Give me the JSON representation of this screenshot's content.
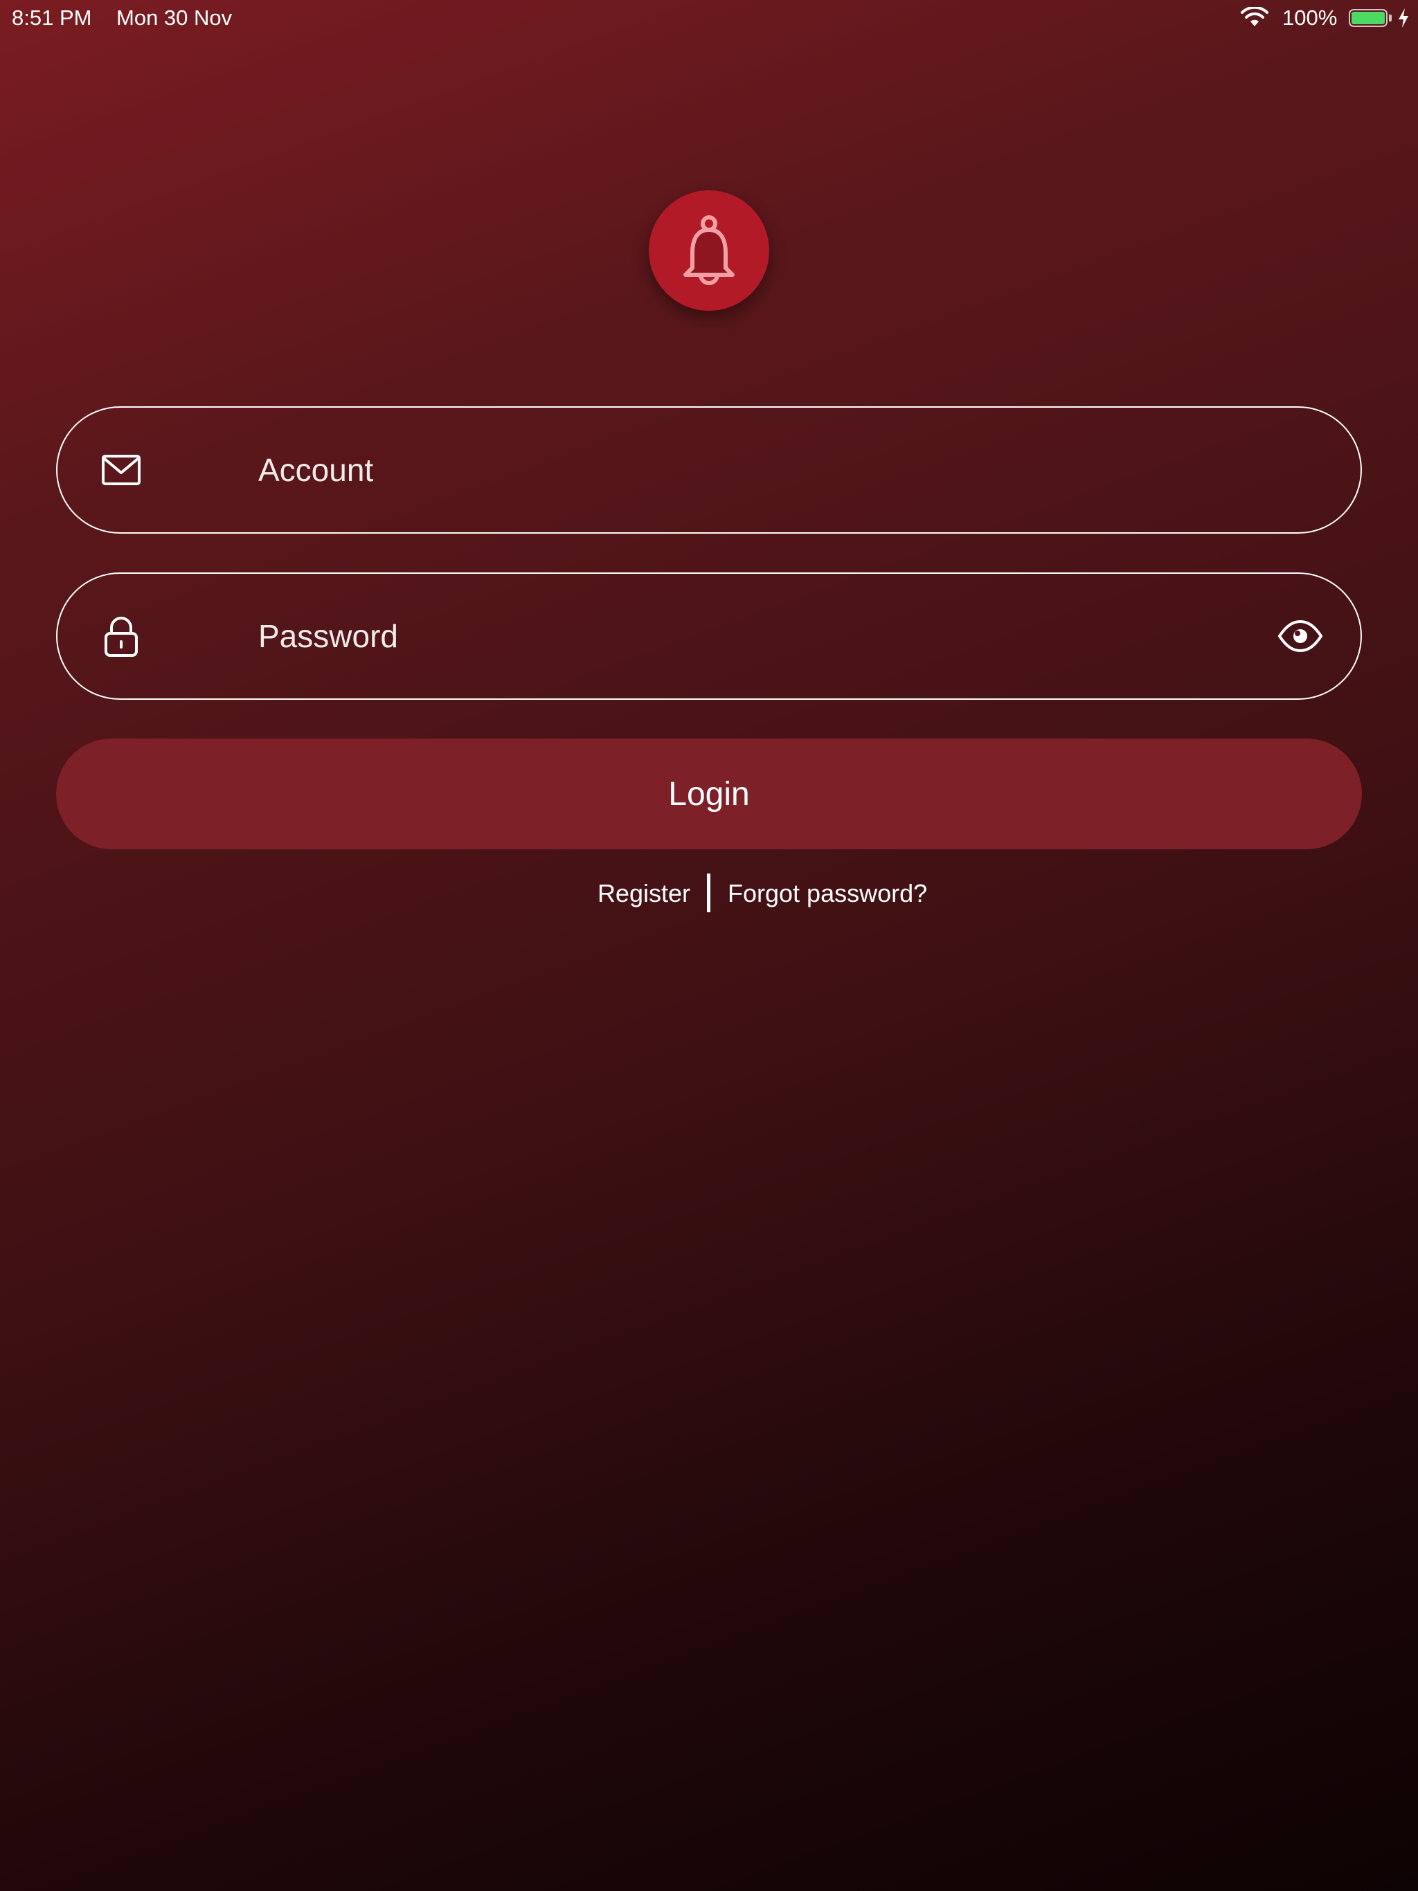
{
  "status_bar": {
    "time": "8:51 PM",
    "date": "Mon 30 Nov",
    "battery_percent": "100%",
    "battery_level": 1.0,
    "charging": true,
    "wifi": "wifi-icon"
  },
  "logo": {
    "icon": "bell-icon",
    "color": "#b31a27"
  },
  "form": {
    "account": {
      "icon": "mail-icon",
      "placeholder": "Account"
    },
    "password": {
      "icon": "lock-icon",
      "placeholder": "Password",
      "toggle_icon": "eye-icon"
    },
    "login_label": "Login"
  },
  "links": {
    "register": "Register",
    "forgot_password": "Forgot password?"
  },
  "colors": {
    "background_top": "#7a1c22",
    "background_bottom": "#0e0304",
    "button": "#7d2028",
    "battery": "#4cd964"
  }
}
